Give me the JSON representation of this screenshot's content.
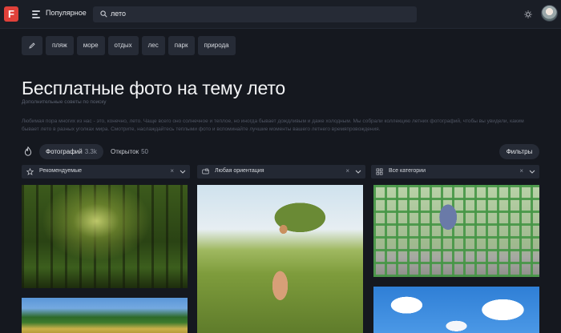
{
  "header": {
    "logo_letter": "F",
    "nav_label": "Популярное",
    "search_value": "лето"
  },
  "tags": [
    "пляж",
    "море",
    "отдых",
    "лес",
    "парк",
    "природа"
  ],
  "page": {
    "title": "Бесплатные фото на тему лето",
    "subtitle": "Дополнительные советы по поиску",
    "description": "Любимая пора многих из нас - это, конечно, лето. Чаще всего оно солнечное и теплое, но иногда бывает дождливым и даже холодным. Мы собрали коллекцию летних фотографий, чтобы вы увидели, каким бывает лето в разных уголках мира. Смотрите, наслаждайтесь теплыми фото и вспоминайте лучшие моменты вашего летнего времяпровождения."
  },
  "tabs": {
    "photos_label": "Фотографий",
    "photos_count": "3.3k",
    "collections_label": "Открыток",
    "collections_count": "50",
    "filters_label": "Фильтры"
  },
  "filters": [
    {
      "label": "Рекомендуемые",
      "icon": "star-icon"
    },
    {
      "label": "Любая ориентация",
      "icon": "orientation-icon"
    },
    {
      "label": "Все категории",
      "icon": "grid-icon"
    }
  ],
  "clear_symbol": "×",
  "photos": [
    {
      "name": "forest-sunlight"
    },
    {
      "name": "woman-in-tall-grass"
    },
    {
      "name": "woman-on-bench-trellis"
    },
    {
      "name": "green-field-blue-sky"
    },
    {
      "name": "clouds-blue-sky"
    }
  ],
  "colors": {
    "background": "#15181f",
    "header": "#1a1e26",
    "chip": "#262b36",
    "logo": "#e0413a"
  }
}
